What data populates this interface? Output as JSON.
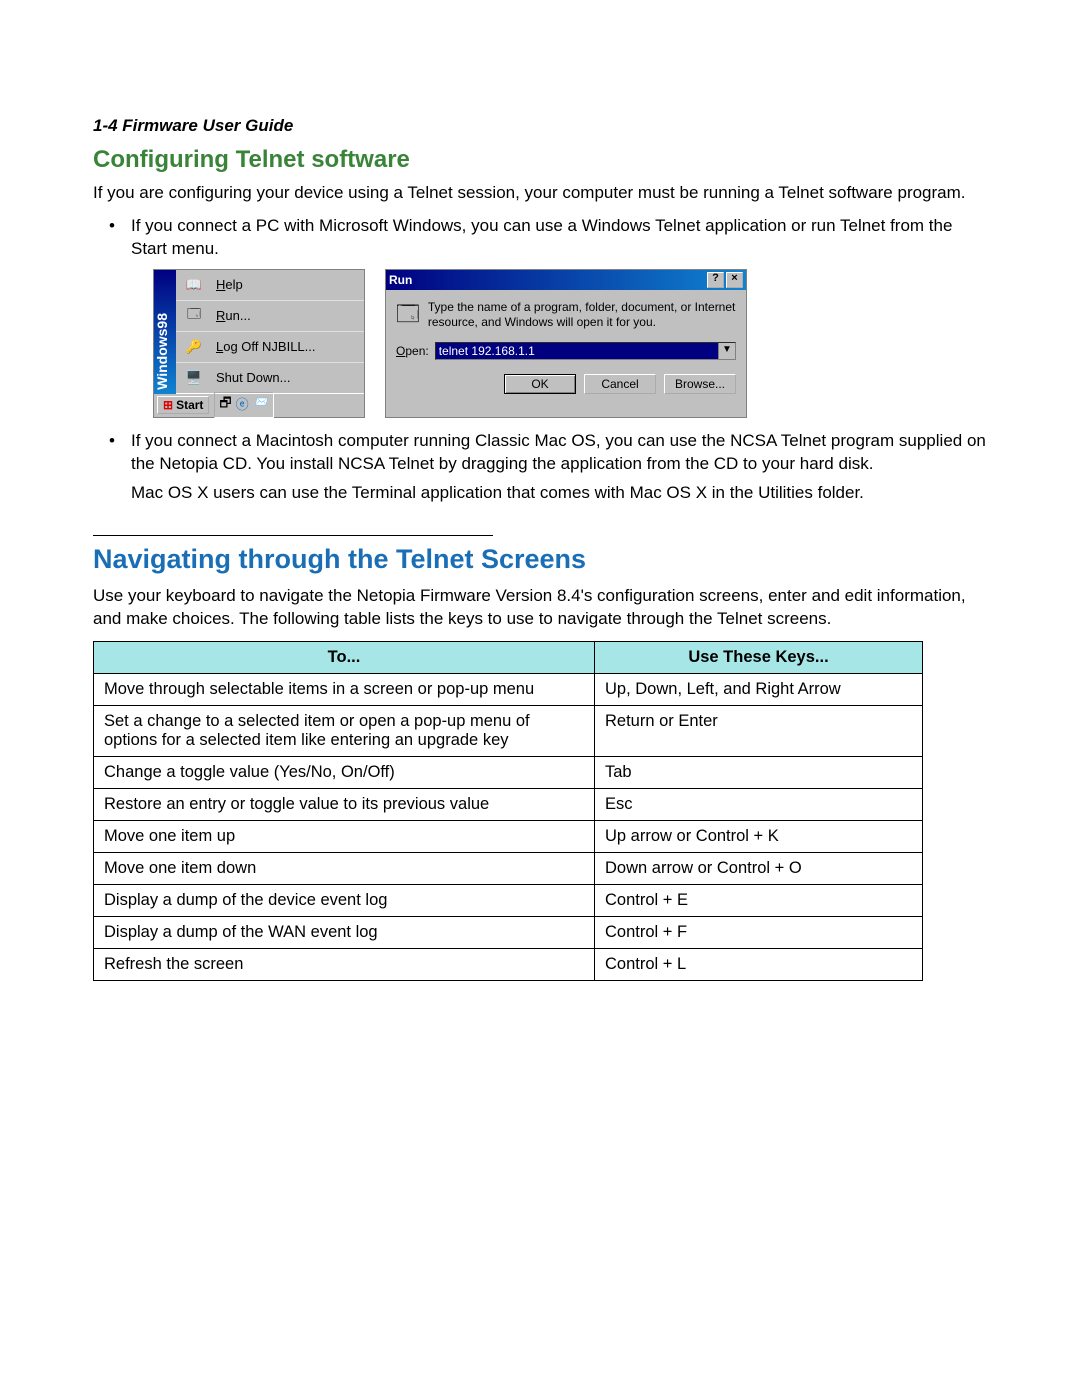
{
  "header": "1-4  Firmware User Guide",
  "section1": {
    "title": "Configuring Telnet software",
    "intro": "If you are configuring your device using a Telnet session, your computer must be running a Telnet software program.",
    "bullets": [
      "If you connect a PC with Microsoft Windows, you can use a Windows Telnet application or run Telnet from the Start menu.",
      "If you connect a Macintosh computer running Classic Mac OS, you can use the NCSA Telnet program supplied on the Netopia CD. You install NCSA Telnet by dragging the application from the CD to your hard disk."
    ],
    "mac_note": "Mac OS X users can use the Terminal application that comes with Mac OS X in the Utilities folder."
  },
  "start_menu": {
    "sidebar": "Windows98",
    "items": [
      "Help",
      "Run...",
      "Log Off NJBILL...",
      "Shut Down..."
    ],
    "start_btn": "Start"
  },
  "run_dialog": {
    "title": "Run",
    "desc": "Type the name of a program, folder, document, or Internet resource, and Windows will open it for you.",
    "open_label": "Open:",
    "open_value": "telnet 192.168.1.1",
    "buttons": {
      "ok": "OK",
      "cancel": "Cancel",
      "browse": "Browse..."
    }
  },
  "section2": {
    "title": "Navigating through the Telnet Screens",
    "intro": "Use your keyboard to navigate the Netopia Firmware Version 8.4's configuration screens, enter and edit information, and make choices. The following table lists the keys to use to navigate through the Telnet screens.",
    "table": {
      "head": {
        "to": "To...",
        "keys": "Use These Keys..."
      },
      "rows": [
        {
          "to": "Move through selectable items in a screen or pop-up menu",
          "keys": "Up, Down, Left, and Right Arrow"
        },
        {
          "to": "Set a change to a selected item or open a pop-up menu of options for a selected item like entering an upgrade key",
          "keys": "Return or Enter"
        },
        {
          "to": "Change a toggle value (Yes/No, On/Off)",
          "keys": "Tab"
        },
        {
          "to": "Restore an entry or toggle value to its previous value",
          "keys": "Esc"
        },
        {
          "to": "Move one item up",
          "keys": "Up arrow or Control + K"
        },
        {
          "to": "Move one item down",
          "keys": "Down arrow or Control + O"
        },
        {
          "to": "Display a dump of the device event log",
          "keys": "Control + E"
        },
        {
          "to": "Display a dump of the WAN event log",
          "keys": "Control + F"
        },
        {
          "to": "Refresh the screen",
          "keys": "Control + L"
        }
      ]
    }
  }
}
